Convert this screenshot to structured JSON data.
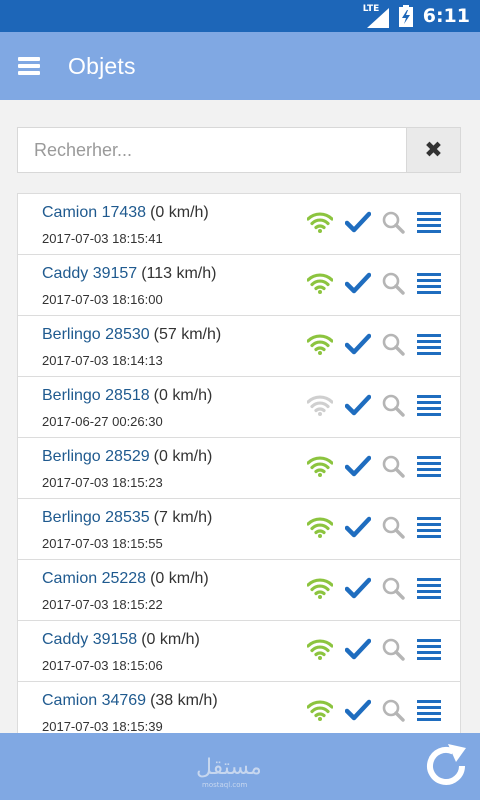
{
  "status_bar": {
    "time": "6:11",
    "network": "LTE",
    "icons": [
      "lte-signal-icon",
      "battery-charging-icon"
    ]
  },
  "app_bar": {
    "title": "Objets",
    "menu_icon": "hamburger-menu-icon"
  },
  "search": {
    "placeholder": "Recherher...",
    "value": "",
    "clear_icon": "close-x-icon"
  },
  "colors": {
    "status_bar": "#1d66b8",
    "app_bar": "#80a8e3",
    "name_text": "#1f5a8f",
    "accent_blue": "#1f6dbf",
    "wifi_active": "#8cc43f",
    "wifi_inactive": "#cfcfcf",
    "search_icon": "#b5b5b5"
  },
  "vehicles": [
    {
      "name": "Camion 17438",
      "speed": "(0 km/h)",
      "timestamp": "2017-07-03 18:15:41",
      "signal": "active"
    },
    {
      "name": "Caddy 39157",
      "speed": "(113 km/h)",
      "timestamp": "2017-07-03 18:16:00",
      "signal": "active"
    },
    {
      "name": "Berlingo 28530",
      "speed": "(57 km/h)",
      "timestamp": "2017-07-03 18:14:13",
      "signal": "active"
    },
    {
      "name": "Berlingo 28518",
      "speed": "(0 km/h)",
      "timestamp": "2017-06-27 00:26:30",
      "signal": "inactive"
    },
    {
      "name": "Berlingo 28529",
      "speed": "(0 km/h)",
      "timestamp": "2017-07-03 18:15:23",
      "signal": "active"
    },
    {
      "name": "Berlingo 28535",
      "speed": "(7 km/h)",
      "timestamp": "2017-07-03 18:15:55",
      "signal": "active"
    },
    {
      "name": "Camion 25228",
      "speed": "(0 km/h)",
      "timestamp": "2017-07-03 18:15:22",
      "signal": "active"
    },
    {
      "name": "Caddy 39158",
      "speed": "(0 km/h)",
      "timestamp": "2017-07-03 18:15:06",
      "signal": "active"
    },
    {
      "name": "Camion 34769",
      "speed": "(38 km/h)",
      "timestamp": "2017-07-03 18:15:39",
      "signal": "active"
    }
  ],
  "row_icons": [
    "wifi-signal-icon",
    "checkmark-icon",
    "magnifier-icon",
    "list-menu-icon"
  ],
  "bottom_bar": {
    "watermark": "مستقل",
    "watermark_sub": "mostaql.com",
    "refresh_icon": "refresh-icon"
  }
}
